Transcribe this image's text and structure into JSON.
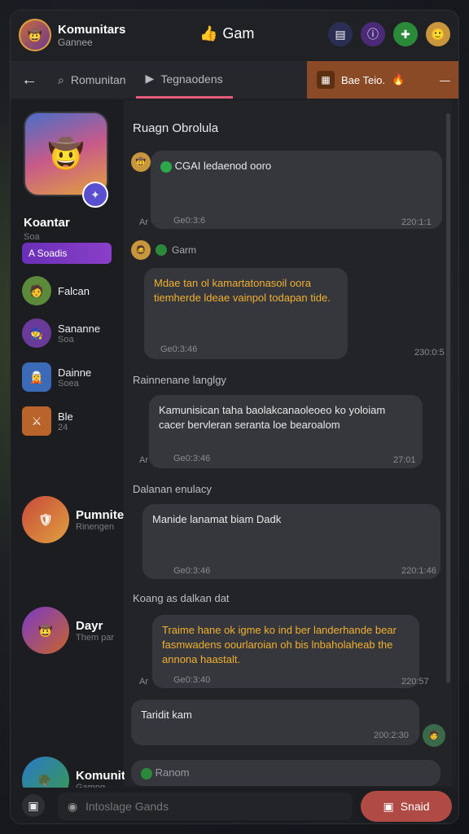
{
  "header": {
    "title": "Komunitars",
    "subtitle": "Gannee",
    "center_label": "Gam",
    "center_icon": "thumbs-up-icon"
  },
  "tabs": {
    "back_icon": "arrow-left-icon",
    "items": [
      {
        "label": "Romunitan",
        "icon": "search-icon"
      },
      {
        "label": "Tegnaodens",
        "icon": "play-icon"
      }
    ],
    "right_label": "Bae Teio."
  },
  "sidebar": {
    "profile_name": "Koantar",
    "profile_sub": "Soa",
    "tag": "A Soadis",
    "items": [
      {
        "name": "Falcan",
        "sub": ""
      },
      {
        "name": "Sananne",
        "sub": "Soa"
      },
      {
        "name": "Dainne",
        "sub": "Soea"
      },
      {
        "name": "Ble",
        "sub": "24"
      }
    ],
    "large_items": [
      {
        "name": "Pumnite",
        "sub": "Rinengen"
      },
      {
        "name": "Dayr",
        "sub": "Them par"
      },
      {
        "name": "Komunit",
        "sub": "Gamng"
      }
    ]
  },
  "chat": {
    "title": "Ruagn Obrolula",
    "messages": [
      {
        "text": "CGAI ledaenod ooro",
        "meta_left": "Ar",
        "time_small": "Ge0:3:6",
        "time": "220:1:1"
      },
      {
        "sender": "Garm",
        "text": "Mdae tan ol kamartatonasoil oora tiemherde ldeae vainpol todapan tide.",
        "meta_left": "",
        "time_small": "Ge0:3:46",
        "time": "230:0:5"
      },
      {
        "section": "Rainnenane langlgy",
        "text": "Kamunisican taha baolakcanaoleoeo ko yoloiam cacer bervleran seranta loe bearoalom",
        "meta_left": "Ar",
        "time_small": "Ge0:3:46",
        "time": "27:01"
      },
      {
        "section": "Dalanan enulacy",
        "text": "Manide lanamat biam Dadk",
        "meta_left": "",
        "time_small": "Ge0:3:46",
        "time": "220:1:46"
      },
      {
        "section": "Koang as dalkan dat",
        "text": "Traime hane ok igme ko ind ber landerhande bear fasmwadens oourlaroian oh bis lnbaholaheab the annona haastalt.",
        "meta_left": "Ar",
        "time_small": "Ge0:3:40",
        "time": "220:57"
      },
      {
        "text": "Taridit kam",
        "time": "200:2:30"
      },
      {
        "text": "Ranom"
      }
    ]
  },
  "composer": {
    "placeholder": "Intoslage Gands",
    "send_label": "Snaid"
  },
  "colors": {
    "accent": "#e75c7a",
    "send": "#b04a44",
    "tag": "#7a38c0",
    "orange_text": "#f0b030"
  }
}
